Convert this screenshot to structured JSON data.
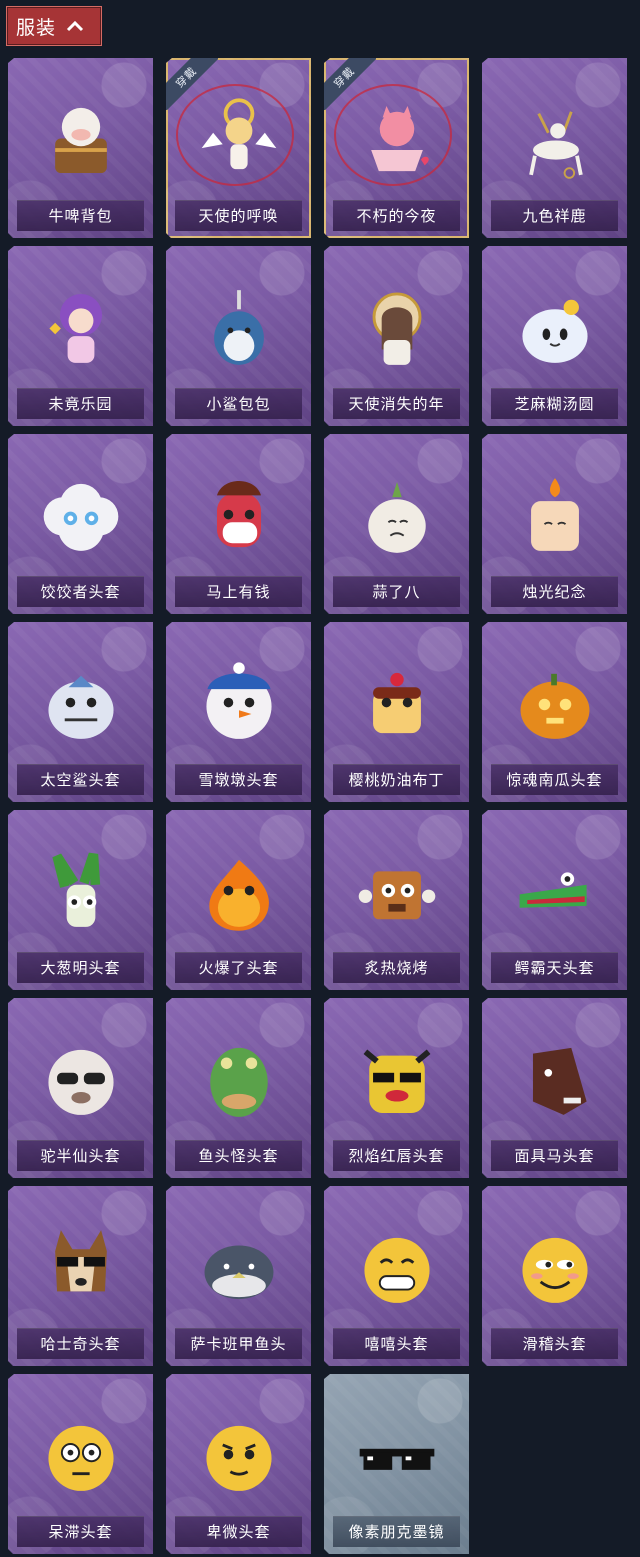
{
  "header": {
    "tab_label": "服装",
    "tab_icon": "chevron-up-icon"
  },
  "colors": {
    "background": "#141b27",
    "tab": "#a63436",
    "card_purple": "#7a5aa3",
    "card_grey": "#8293a3",
    "equipped_border": "#d9b56e"
  },
  "items": [
    {
      "name": "牛啤背包",
      "badge": "",
      "art": "cow-cup"
    },
    {
      "name": "天使的呼唤",
      "badge": "穿戴",
      "art": "angel"
    },
    {
      "name": "不朽的今夜",
      "badge": "穿戴",
      "art": "pink-fox-bowl"
    },
    {
      "name": "九色祥鹿",
      "badge": "",
      "art": "deer"
    },
    {
      "name": "未竟乐园",
      "badge": "",
      "art": "purple-girl"
    },
    {
      "name": "小鲨包包",
      "badge": "",
      "art": "shark-plush"
    },
    {
      "name": "天使消失的年",
      "badge": "",
      "art": "doll"
    },
    {
      "name": "芝麻糊汤圆",
      "badge": "",
      "art": "dumpling"
    },
    {
      "name": "饺饺者头套",
      "badge": "",
      "art": "cloud-head"
    },
    {
      "name": "马上有钱",
      "badge": "",
      "art": "red-horse"
    },
    {
      "name": "蒜了八",
      "badge": "",
      "art": "garlic"
    },
    {
      "name": "烛光纪念",
      "badge": "",
      "art": "candle"
    },
    {
      "name": "太空鲨头套",
      "badge": "",
      "art": "space-shark"
    },
    {
      "name": "雪墩墩头套",
      "badge": "",
      "art": "snowman"
    },
    {
      "name": "樱桃奶油布丁",
      "badge": "",
      "art": "pudding"
    },
    {
      "name": "惊魂南瓜头套",
      "badge": "",
      "art": "pumpkin"
    },
    {
      "name": "大葱明头套",
      "badge": "",
      "art": "scallion"
    },
    {
      "name": "火爆了头套",
      "badge": "",
      "art": "fire"
    },
    {
      "name": "炙热烧烤",
      "badge": "",
      "art": "meat"
    },
    {
      "name": "鳄霸天头套",
      "badge": "",
      "art": "crocodile"
    },
    {
      "name": "驼半仙头套",
      "badge": "",
      "art": "alpaca"
    },
    {
      "name": "鱼头怪头套",
      "badge": "",
      "art": "fish-mask"
    },
    {
      "name": "烈焰红唇头套",
      "badge": "",
      "art": "yellow-mask"
    },
    {
      "name": "面具马头套",
      "badge": "",
      "art": "horse-mask"
    },
    {
      "name": "哈士奇头套",
      "badge": "",
      "art": "dog"
    },
    {
      "name": "萨卡班甲鱼头",
      "badge": "",
      "art": "ancient-fish"
    },
    {
      "name": "嘻嘻头套",
      "badge": "",
      "art": "grin-emoji"
    },
    {
      "name": "滑稽头套",
      "badge": "",
      "art": "funny-emoji"
    },
    {
      "name": "呆滞头套",
      "badge": "",
      "art": "stunned-emoji"
    },
    {
      "name": "卑微头套",
      "badge": "",
      "art": "humble-emoji"
    },
    {
      "name": "像素朋克墨镜",
      "badge": "",
      "art": "pixel-sunglasses",
      "grey": true
    }
  ]
}
